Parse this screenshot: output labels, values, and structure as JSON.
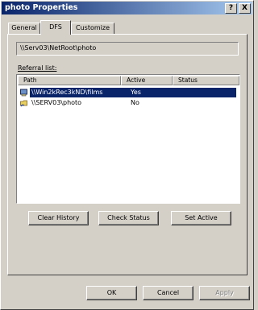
{
  "window": {
    "title": "photo Properties"
  },
  "titlebar_buttons": {
    "help": "?",
    "close": "X"
  },
  "tabs": [
    {
      "label": "General",
      "active": false
    },
    {
      "label": "DFS",
      "active": true
    },
    {
      "label": "Customize",
      "active": false
    }
  ],
  "dfs": {
    "path": "\\\\Serv03\\NetRoot\\photo",
    "referral_label": "Referral list:",
    "columns": [
      "Path",
      "Active",
      "Status"
    ],
    "rows": [
      {
        "path": "\\\\Win2kRec3kND\\films",
        "active": "Yes",
        "status": "",
        "selected": true
      },
      {
        "path": "\\\\SERV03\\photo",
        "active": "No",
        "status": "",
        "selected": false
      }
    ],
    "buttons": {
      "clear_history": "Clear History",
      "check_status": "Check Status",
      "set_active": "Set Active"
    }
  },
  "dialog_buttons": {
    "ok": "OK",
    "cancel": "Cancel",
    "apply": "Apply"
  },
  "colors": {
    "title_start": "#0a246a",
    "title_end": "#a6caf0",
    "selection": "#0a246a",
    "face": "#d4d0c8"
  }
}
